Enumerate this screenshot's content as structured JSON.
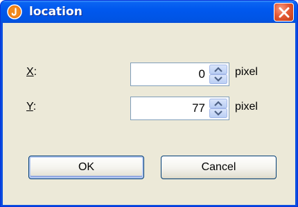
{
  "window": {
    "title": "location",
    "icon": "orange-circle-app-icon",
    "close_icon": "close-x-icon",
    "accent": "#0054e3",
    "close_color": "#e45a35"
  },
  "fields": [
    {
      "label_mnemonic": "X",
      "label_rest": ":",
      "value": "0",
      "unit": "pixel"
    },
    {
      "label_mnemonic": "Y",
      "label_rest": ":",
      "value": "77",
      "unit": "pixel"
    }
  ],
  "buttons": {
    "ok_label": "OK",
    "cancel_label": "Cancel"
  }
}
